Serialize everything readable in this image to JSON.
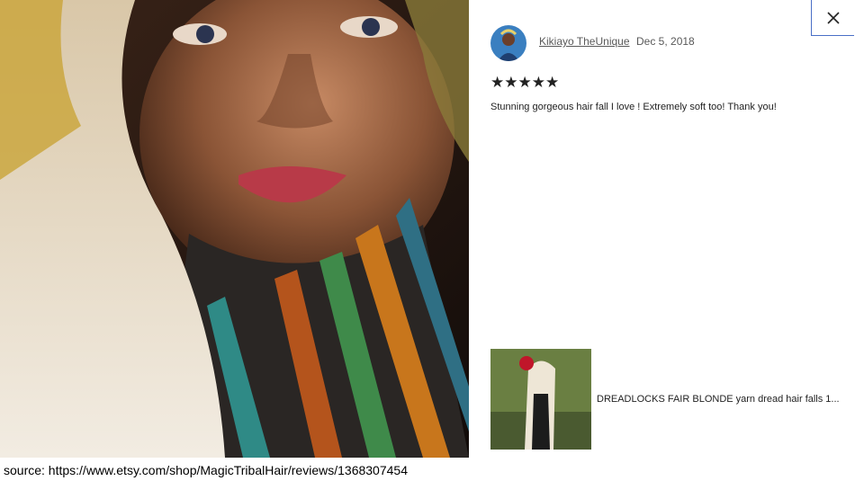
{
  "review": {
    "reviewer_name": "Kikiayo TheUnique",
    "date": "Dec 5, 2018",
    "rating": 5,
    "stars": "★★★★★",
    "text": "Stunning gorgeous hair fall I love ! Extremely soft too! Thank you!"
  },
  "product": {
    "title": "DREADLOCKS FAIR BLONDE yarn dread hair falls 1..."
  },
  "icons": {
    "close": "close-icon"
  },
  "caption": "source: https://www.etsy.com/shop/MagicTribalHair/reviews/1368307454"
}
